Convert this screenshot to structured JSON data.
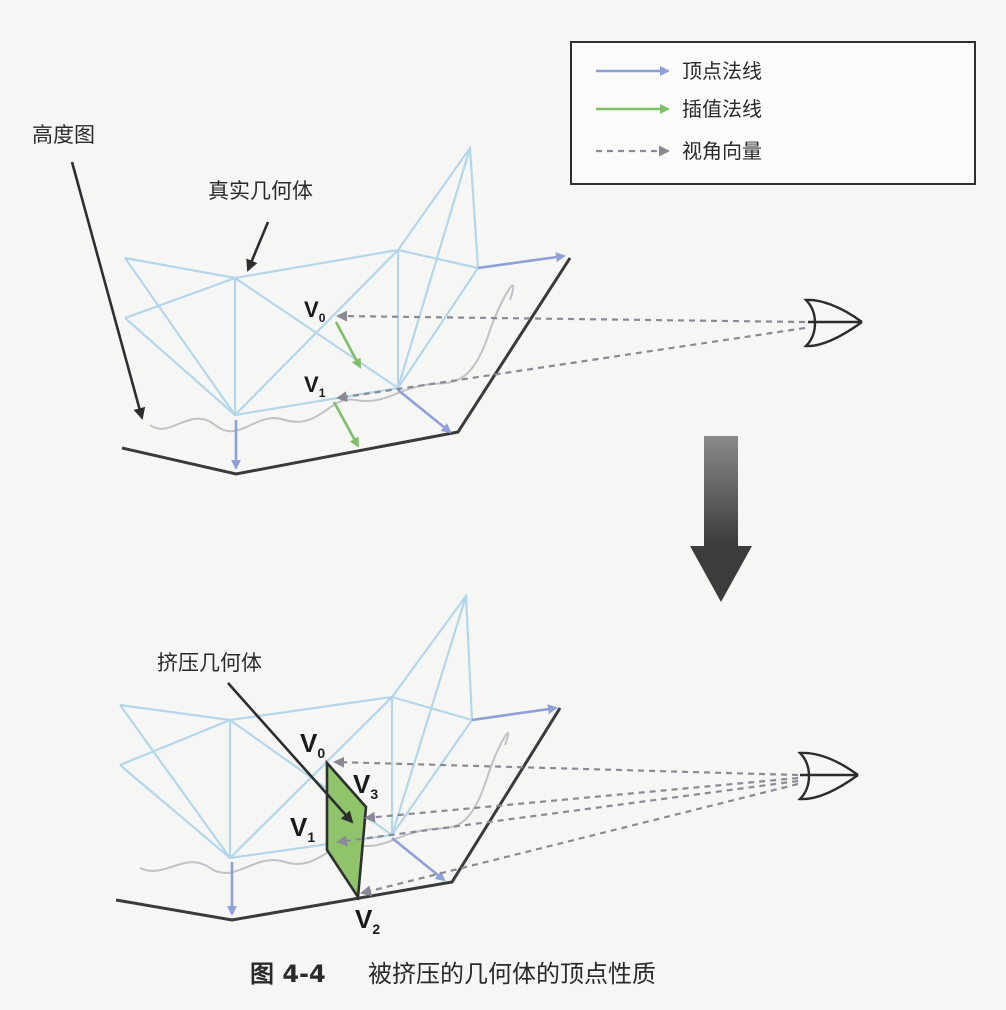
{
  "legend": {
    "items": [
      {
        "label": "顶点法线",
        "style": "solid",
        "color": "#8f9fd8"
      },
      {
        "label": "插值法线",
        "style": "solid",
        "color": "#7fbf6a"
      },
      {
        "label": "视角向量",
        "style": "dashed",
        "color": "#8a8a96"
      }
    ]
  },
  "top_panel": {
    "heightmap_label": "高度图",
    "real_geometry_label": "真实几何体",
    "v0": {
      "letter": "V",
      "sub": "0"
    },
    "v1": {
      "letter": "V",
      "sub": "1"
    }
  },
  "bottom_panel": {
    "extruded_label": "挤压几何体",
    "v0": {
      "letter": "V",
      "sub": "0"
    },
    "v1": {
      "letter": "V",
      "sub": "1"
    },
    "v2": {
      "letter": "V",
      "sub": "2"
    },
    "v3": {
      "letter": "V",
      "sub": "3"
    }
  },
  "caption": {
    "number": "图 4-4",
    "text": "被挤压的几何体的顶点性质"
  },
  "colors": {
    "vertex_normal": "#8f9fd8",
    "interpolated_normal": "#7fbf6a",
    "view_vector": "#8a8a96",
    "geometry": "#b4d6ea",
    "extruded_fill": "#8fc46a",
    "transition_arrow": "#4a4a4a"
  }
}
